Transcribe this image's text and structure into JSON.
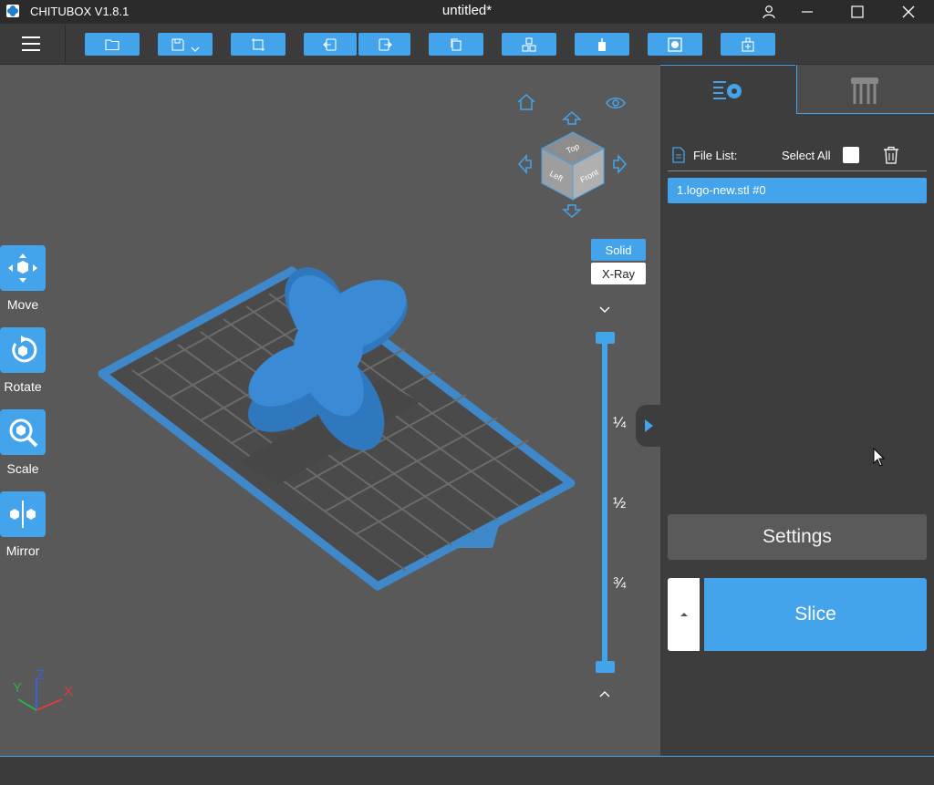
{
  "titlebar": {
    "app_name": "CHITUBOX V1.8.1",
    "doc_title": "untitled*"
  },
  "toolbar": {
    "buttons": [
      "open-file-icon",
      "save-icon",
      "screenshot-icon",
      "undo-icon",
      "redo-icon",
      "copy-icon",
      "arrange-icon",
      "support-icon",
      "hollow-icon",
      "dig-hole-icon"
    ]
  },
  "tools": {
    "move": "Move",
    "rotate": "Rotate",
    "scale": "Scale",
    "mirror": "Mirror"
  },
  "viewmode": {
    "solid": "Solid",
    "xray": "X-Ray",
    "active": "Solid"
  },
  "slider": {
    "quarter": "¼",
    "half": "½",
    "three_quarter": "¾"
  },
  "viewcube": {
    "top": "Top",
    "front": "Front",
    "left": "Left"
  },
  "axes": {
    "x": "X",
    "y": "Y",
    "z": "Z"
  },
  "panel": {
    "file_list_label": "File List:",
    "select_all_label": "Select All",
    "files": [
      "1.logo-new.stl #0"
    ],
    "settings_label": "Settings",
    "slice_label": "Slice"
  },
  "colors": {
    "accent": "#44a4eb",
    "background": "#595959",
    "panel": "#3d3d3d",
    "titlebar": "#2b2b2b"
  }
}
